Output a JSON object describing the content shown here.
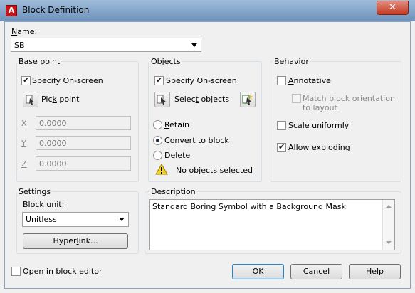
{
  "window": {
    "title": "Block Definition",
    "close_glyph": "✕"
  },
  "name": {
    "label_prefix": "N",
    "label_rest": "ame:",
    "value": "SB"
  },
  "base_point": {
    "title": "Base point",
    "specify_label": "Specify On-screen",
    "pick_label_a": "Pic",
    "pick_label_u": "k",
    "pick_label_b": " point",
    "x_label": "X",
    "x_value": "0.0000",
    "y_label": "Y",
    "y_value": "0.0000",
    "z_label": "Z",
    "z_value": "0.0000"
  },
  "objects": {
    "title": "Objects",
    "specify_label": "Specify On-screen",
    "select_label_a": "Selec",
    "select_label_u": "t",
    "select_label_b": " objects",
    "retain_u": "R",
    "retain_rest": "etain",
    "convert_u": "C",
    "convert_rest": "onvert to block",
    "delete_u": "D",
    "delete_rest": "elete",
    "status": "No objects selected"
  },
  "behavior": {
    "title": "Behavior",
    "annotative_u": "A",
    "annotative_rest": "nnotative",
    "match_u": "M",
    "match_line1_rest": "atch block orientation",
    "match_line2": "to layout",
    "scale_u": "S",
    "scale_rest": "cale uniformly",
    "allow_a": "Allow ex",
    "allow_u": "p",
    "allow_b": "loding"
  },
  "settings": {
    "title": "Settings",
    "unit_label_a": "Block ",
    "unit_label_u": "u",
    "unit_label_b": "nit:",
    "unit_value": "Unitless",
    "hyperlink_a": "Hyper",
    "hyperlink_u": "l",
    "hyperlink_b": "ink..."
  },
  "description": {
    "title": "Description",
    "text": "Standard Boring Symbol with a Background Mask"
  },
  "footer": {
    "open_u": "O",
    "open_rest": "pen in block editor",
    "ok": "OK",
    "cancel": "Cancel",
    "help_u": "H",
    "help_rest": "elp"
  }
}
